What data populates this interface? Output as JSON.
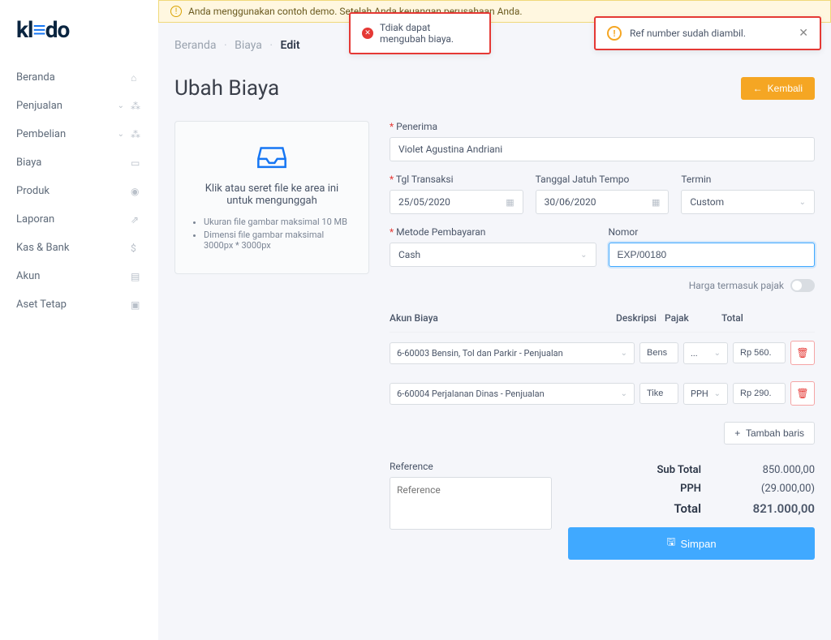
{
  "logo": {
    "pre": "kl",
    "accent": "≡",
    "post": "do"
  },
  "banner": "Anda menggunakan contoh demo. Setelah Anda                                                        keuangan perusahaan Anda.",
  "popup1": "Tdiak dapat mengubah biaya.",
  "popup2": "Ref number sudah diambil.",
  "nav": [
    {
      "label": "Beranda",
      "icon": "⌂",
      "chevron": false
    },
    {
      "label": "Penjualan",
      "icon": "🛍",
      "chevron": true
    },
    {
      "label": "Pembelian",
      "icon": "🛍",
      "chevron": true
    },
    {
      "label": "Biaya",
      "icon": "▭",
      "chevron": false
    },
    {
      "label": "Produk",
      "icon": "◉",
      "chevron": false
    },
    {
      "label": "Laporan",
      "icon": "📈",
      "chevron": false
    },
    {
      "label": "Kas & Bank",
      "icon": "$",
      "chevron": false
    },
    {
      "label": "Akun",
      "icon": "▤",
      "chevron": false
    },
    {
      "label": "Aset Tetap",
      "icon": "▣",
      "chevron": false
    }
  ],
  "crumbs": {
    "a": "Beranda",
    "b": "Biaya",
    "c": "Edit"
  },
  "page": {
    "title": "Ubah Biaya",
    "back": "Kembali"
  },
  "upload": {
    "title": "Klik atau seret file ke area ini untuk mengunggah",
    "hints": [
      "Ukuran file gambar maksimal 10 MB",
      "Dimensi file gambar maksimal 3000px * 3000px"
    ]
  },
  "form": {
    "penerima_label": "Penerima",
    "penerima_value": "Violet Agustina Andriani",
    "tgl_label": "Tgl Transaksi",
    "tgl_value": "25/05/2020",
    "jatuh_label": "Tanggal Jatuh Tempo",
    "jatuh_value": "30/06/2020",
    "termin_label": "Termin",
    "termin_value": "Custom",
    "metode_label": "Metode Pembayaran",
    "metode_value": "Cash",
    "nomor_label": "Nomor",
    "nomor_value": "EXP/00180",
    "tax_toggle": "Harga termasuk pajak"
  },
  "table": {
    "headers": {
      "akun": "Akun Biaya",
      "desk": "Deskripsi",
      "pajak": "Pajak",
      "total": "Total"
    },
    "rows": [
      {
        "akun": "6-60003 Bensin, Tol dan Parkir - Penjualan",
        "desk": "Bens",
        "pajak": "...",
        "total": "Rp 560."
      },
      {
        "akun": "6-60004 Perjalanan Dinas - Penjualan",
        "desk": "Tike",
        "pajak": "PPH",
        "total": "Rp 290."
      }
    ],
    "add": "Tambah baris"
  },
  "reference": {
    "label": "Reference",
    "placeholder": "Reference"
  },
  "totals": {
    "subtotal_label": "Sub Total",
    "subtotal_value": "850.000,00",
    "pph_label": "PPH",
    "pph_value": "(29.000,00)",
    "total_label": "Total",
    "total_value": "821.000,00"
  },
  "save": "Simpan"
}
